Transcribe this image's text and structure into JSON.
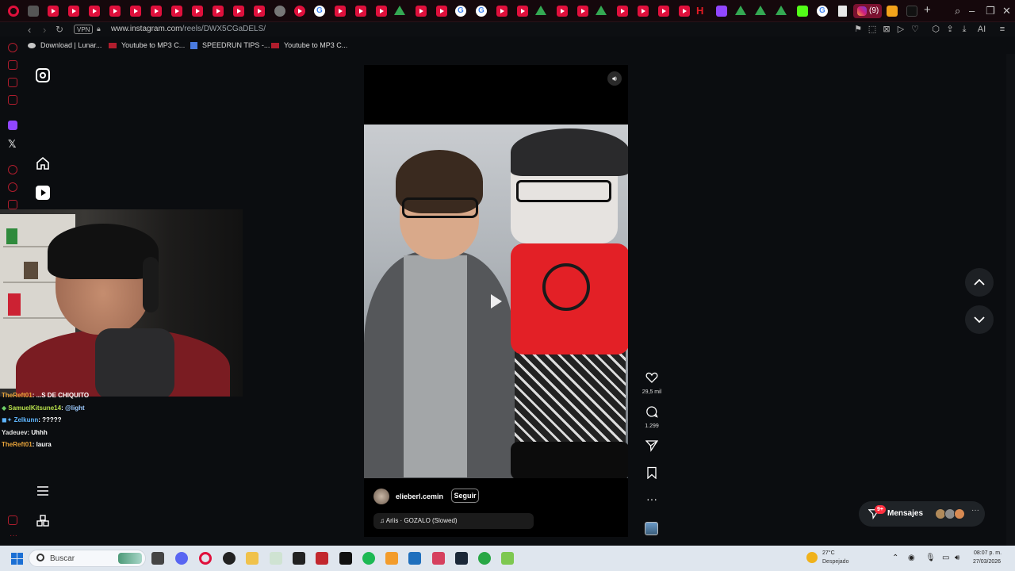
{
  "browser": {
    "url_host": "www.instagram.com",
    "url_path": "/reels/DWX5CGaDELS/",
    "vpn_label": "VPN",
    "active_tab_badge": "(9)",
    "ai_label": "AI",
    "bookmarks": [
      {
        "label": "Download | Lunar...",
        "icon": "lunar-icon"
      },
      {
        "label": "Youtube to MP3 C...",
        "icon": "youtube-mp3-icon"
      },
      {
        "label": "SPEEDRUN TIPS -...",
        "icon": "doc-icon"
      },
      {
        "label": "Youtube to MP3 C...",
        "icon": "youtube-mp3-icon"
      }
    ]
  },
  "chat": [
    {
      "user": "TheReft01",
      "text": ": ...S DE CHIQUITO",
      "color": "orange"
    },
    {
      "user": "SamuelKitsune14",
      "text": ": ",
      "mention": "@light",
      "color": "green"
    },
    {
      "user": "Zelkunn",
      "text": ": ?????",
      "color": "blue"
    },
    {
      "user": "Yadeuev",
      "text": ": Uhhh",
      "color": "gray"
    },
    {
      "user": "TheReft01",
      "text": ": laura",
      "color": "orange"
    }
  ],
  "reel": {
    "username": "elieberl.cemin",
    "follow_label": "Seguir",
    "audio": "Ariis · GOZALO (Slowed)",
    "likes": "29,5 mil",
    "comments": "1.299"
  },
  "messages": {
    "label": "Mensajes",
    "badge": "9+"
  },
  "taskbar": {
    "search_placeholder": "Buscar",
    "temperature": "27°C",
    "weather": "Despejado",
    "time": "08:07 p. m.",
    "date": "27/03/2026"
  },
  "colors": {
    "opera_red": "#e0103c",
    "page_bg": "#0b0d10",
    "like_badge": "#ff3040",
    "roblox_shirt": "#e32026"
  }
}
